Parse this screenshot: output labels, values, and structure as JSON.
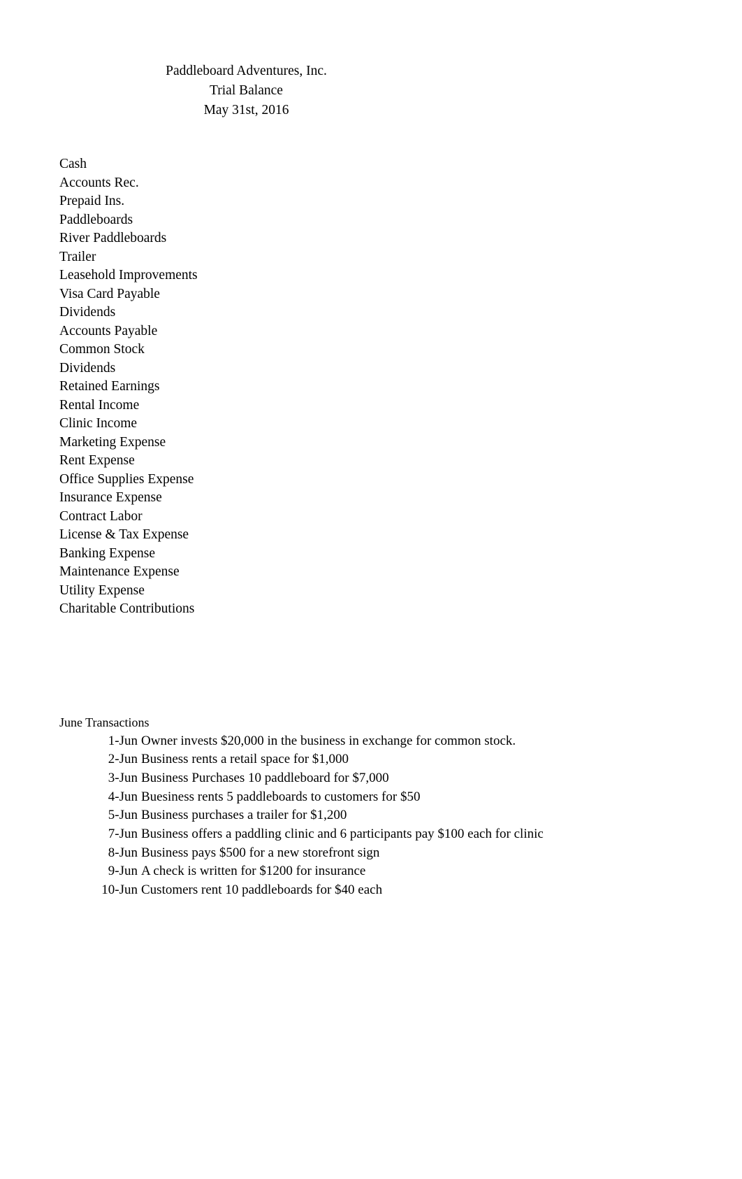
{
  "document": {
    "header": {
      "company": "Paddleboard Adventures, Inc.",
      "report": "Trial Balance",
      "date": "May 31st, 2016"
    },
    "accounts": [
      {
        "name": "Cash"
      },
      {
        "name": "Accounts Rec."
      },
      {
        "name": "Prepaid Ins."
      },
      {
        "name": "Paddleboards"
      },
      {
        "name": "River Paddleboards"
      },
      {
        "name": "Trailer"
      },
      {
        "name": "Leasehold Improvements"
      },
      {
        "name": "Visa Card Payable"
      },
      {
        "name": "Dividends"
      },
      {
        "name": "Accounts Payable"
      },
      {
        "name": "Common Stock"
      },
      {
        "name": "Dividends"
      },
      {
        "name": "Retained Earnings"
      },
      {
        "name": "Rental Income"
      },
      {
        "name": "Clinic Income"
      },
      {
        "name": "Marketing Expense"
      },
      {
        "name": "Rent Expense"
      },
      {
        "name": "Office Supplies Expense"
      },
      {
        "name": "Insurance Expense"
      },
      {
        "name": "Contract Labor"
      },
      {
        "name": "License & Tax Expense"
      },
      {
        "name": "Banking Expense"
      },
      {
        "name": "Maintenance Expense"
      },
      {
        "name": "Utility Expense"
      },
      {
        "name": "Charitable Contributions"
      }
    ],
    "transactions_section": {
      "title": "June Transactions",
      "rows": [
        {
          "date": "1-Jun",
          "description": "Owner invests $20,000 in the business in exchange for common stock."
        },
        {
          "date": "2-Jun",
          "description": "Business rents a retail space for $1,000"
        },
        {
          "date": "3-Jun",
          "description": "Business Purchases 10 paddleboard for $7,000"
        },
        {
          "date": "4-Jun",
          "description": "Buesiness rents 5 paddleboards to customers for $50"
        },
        {
          "date": "5-Jun",
          "description": "Business purchases a trailer for $1,200"
        },
        {
          "date": "7-Jun",
          "description": "Business offers a paddling clinic and 6 participants pay $100 each for clinic"
        },
        {
          "date": "8-Jun",
          "description": "Business pays $500 for a new storefront sign"
        },
        {
          "date": "9-Jun",
          "description": "A check is written for $1200 for insurance"
        },
        {
          "date": "10-Jun",
          "description": "Customers rent 10 paddleboards for $40 each"
        }
      ]
    }
  }
}
